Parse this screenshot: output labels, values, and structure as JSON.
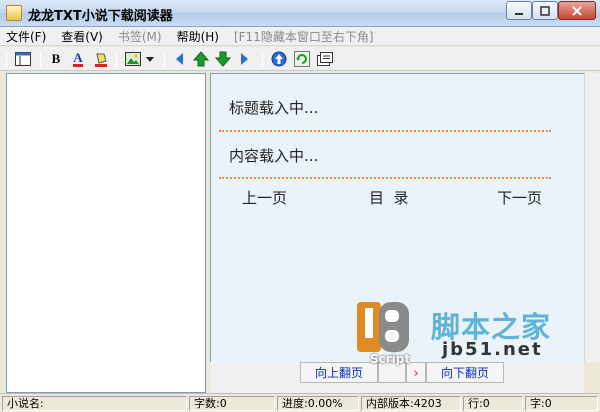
{
  "window": {
    "title": "龙龙TXT小说下载阅读器"
  },
  "menu": [
    {
      "label": "文件(F)",
      "disabled": false
    },
    {
      "label": "查看(V)",
      "disabled": false
    },
    {
      "label": "书签(M)",
      "disabled": true
    },
    {
      "label": "帮助(H)",
      "disabled": false
    },
    {
      "label": "[F11隐藏本窗口至右下角]",
      "disabled": true
    }
  ],
  "toolbar": {
    "bold_label": "B",
    "font_color_label": "A"
  },
  "reader": {
    "title_text": "标题载入中...",
    "content_text": "内容载入中...",
    "prev_page": "上一页",
    "toc": "目  录",
    "next_page": "下一页"
  },
  "page_buttons": {
    "up": "向上翻页",
    "down": "向下翻页"
  },
  "status": {
    "novel_name": "小说名:",
    "word_count": "字数:0",
    "progress": "进度:0.00%",
    "version": "内部版本:4203",
    "line": "行:0",
    "char": "字:0"
  },
  "watermark": {
    "site_cn": "脚本之家",
    "site_url": "jb51.net",
    "script": "Script"
  },
  "colors": {
    "dotted_separator": "#ef8b3c",
    "reader_bg": "#eaf2fa",
    "link_blue": "#0a2fbf"
  }
}
